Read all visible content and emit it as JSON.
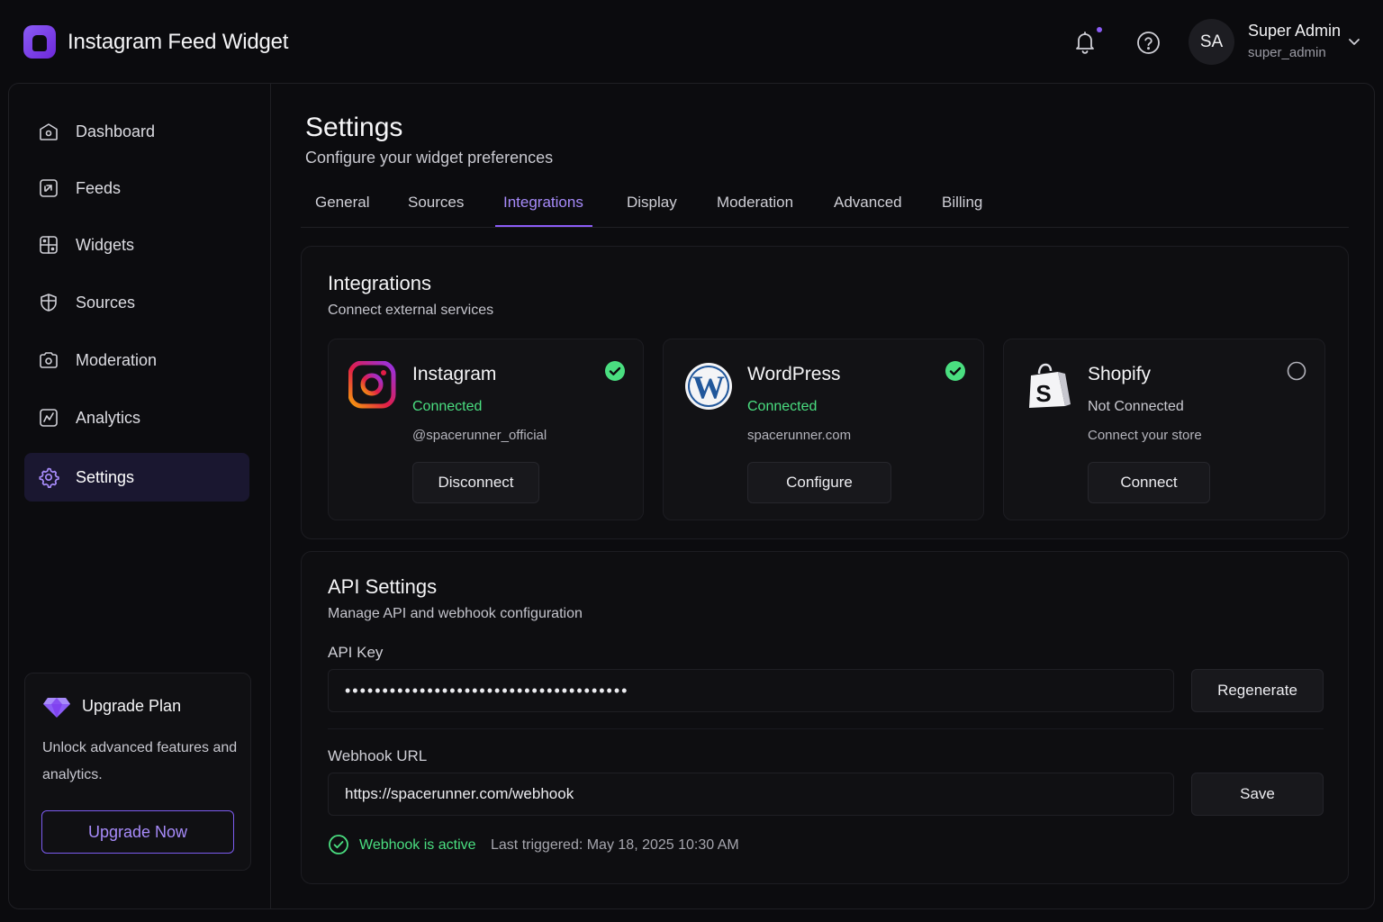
{
  "app": {
    "title": "Instagram Feed Widget"
  },
  "user": {
    "initials": "SA",
    "name": "Super Admin",
    "handle": "super_admin"
  },
  "sidebar": {
    "items": [
      {
        "label": "Dashboard",
        "icon": "dashboard-icon"
      },
      {
        "label": "Feeds",
        "icon": "feeds-icon"
      },
      {
        "label": "Widgets",
        "icon": "widgets-icon"
      },
      {
        "label": "Sources",
        "icon": "sources-icon"
      },
      {
        "label": "Moderation",
        "icon": "moderation-icon"
      },
      {
        "label": "Analytics",
        "icon": "analytics-icon"
      },
      {
        "label": "Settings",
        "icon": "settings-icon",
        "active": true
      }
    ],
    "upgrade": {
      "title": "Upgrade Plan",
      "description": "Unlock advanced features and analytics.",
      "button": "Upgrade Now"
    }
  },
  "page": {
    "title": "Settings",
    "subtitle": "Configure your widget preferences"
  },
  "tabs": [
    "General",
    "Sources",
    "Integrations",
    "Display",
    "Moderation",
    "Advanced",
    "Billing"
  ],
  "active_tab": "Integrations",
  "integrations": {
    "title": "Integrations",
    "subtitle": "Connect external services",
    "cards": [
      {
        "name": "Instagram",
        "status": "Connected",
        "detail": "@spacerunner_official",
        "button": "Disconnect",
        "connected": true
      },
      {
        "name": "WordPress",
        "status": "Connected",
        "detail": "spacerunner.com",
        "button": "Configure",
        "connected": true
      },
      {
        "name": "Shopify",
        "status": "Not Connected",
        "detail": "Connect your store",
        "button": "Connect",
        "connected": false
      }
    ]
  },
  "api": {
    "title": "API Settings",
    "subtitle": "Manage API and webhook configuration",
    "key_label": "API Key",
    "key_value": "••••••••••••••••••••••••••••••••••••••",
    "regenerate_button": "Regenerate",
    "webhook_label": "Webhook URL",
    "webhook_value": "https://spacerunner.com/webhook",
    "save_button": "Save",
    "webhook_status": "Webhook is active",
    "last_triggered": "Last triggered: May 18, 2025 10:30 AM"
  },
  "colors": {
    "accent": "#8b5cf6",
    "connected": "#4ade80",
    "background": "#0b0b0e"
  }
}
